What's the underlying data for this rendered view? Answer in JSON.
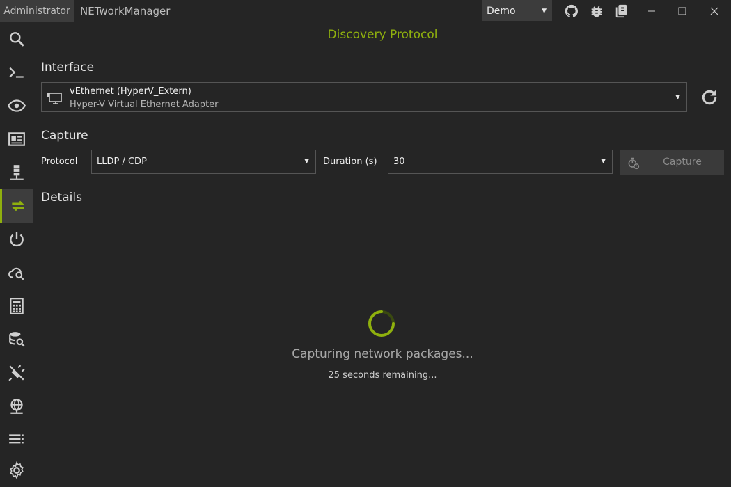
{
  "titlebar": {
    "badge": "Administrator",
    "app_name": "NETworkManager",
    "profile": "Demo"
  },
  "icons": {
    "github": "github-icon",
    "bug": "bug-icon",
    "docs": "book-icon"
  },
  "sidebar": {
    "items": [
      {
        "name": "search",
        "icon": "search-icon"
      },
      {
        "name": "powershell",
        "icon": "terminal-icon"
      },
      {
        "name": "network-interface",
        "icon": "eye-icon"
      },
      {
        "name": "dashboard",
        "icon": "news-card-icon"
      },
      {
        "name": "lookup",
        "icon": "server-network-icon"
      },
      {
        "name": "discovery-protocol",
        "icon": "swap-arrows-icon",
        "active": true
      },
      {
        "name": "wake-on-lan",
        "icon": "power-icon"
      },
      {
        "name": "whois",
        "icon": "cloud-search-icon"
      },
      {
        "name": "subnet-calculator",
        "icon": "calculator-icon"
      },
      {
        "name": "dns-lookup",
        "icon": "database-search-icon"
      },
      {
        "name": "connections",
        "icon": "plug-off-icon"
      },
      {
        "name": "web-console",
        "icon": "web-icon"
      },
      {
        "name": "listeners",
        "icon": "list-icon"
      },
      {
        "name": "settings",
        "icon": "gear-icon"
      }
    ]
  },
  "main": {
    "title": "Discovery Protocol",
    "interface_heading": "Interface",
    "interface": {
      "name": "vEthernet (HyperV_Extern)",
      "description": "Hyper-V Virtual Ethernet Adapter"
    },
    "capture_heading": "Capture",
    "protocol_label": "Protocol",
    "protocol_value": "LLDP / CDP",
    "duration_label": "Duration (s)",
    "duration_value": "30",
    "capture_button": "Capture",
    "details_heading": "Details",
    "status_text": "Capturing network packages...",
    "remaining_text": "25 seconds remaining..."
  },
  "colors": {
    "accent": "#8fb00e",
    "background": "#252525",
    "panel": "#3c3c3c"
  }
}
